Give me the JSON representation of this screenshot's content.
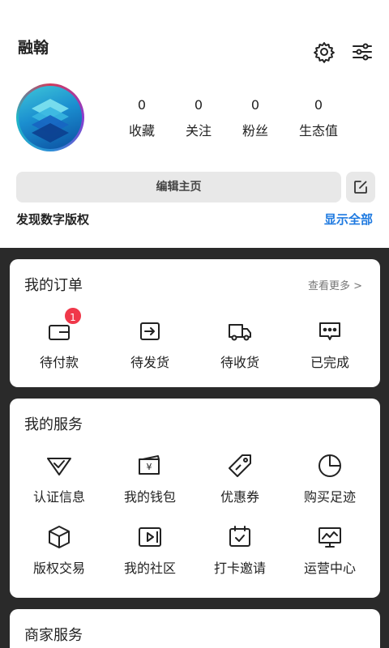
{
  "profile": {
    "username": "融翰",
    "stats": [
      {
        "value": "0",
        "label": "收藏"
      },
      {
        "value": "0",
        "label": "关注"
      },
      {
        "value": "0",
        "label": "粉丝"
      },
      {
        "value": "0",
        "label": "生态值"
      }
    ],
    "edit_button": "编辑主页",
    "discover": "发现数字版权",
    "show_all": "显示全部"
  },
  "orders": {
    "title": "我的订单",
    "more": "查看更多 >",
    "items": [
      {
        "label": "待付款",
        "icon": "wallet-icon",
        "badge": "1"
      },
      {
        "label": "待发货",
        "icon": "box-out-icon"
      },
      {
        "label": "待收货",
        "icon": "truck-icon"
      },
      {
        "label": "已完成",
        "icon": "message-dots-icon"
      }
    ]
  },
  "services": {
    "title": "我的服务",
    "items": [
      {
        "label": "认证信息",
        "icon": "check-shield-icon"
      },
      {
        "label": "我的钱包",
        "icon": "wallet-yen-icon"
      },
      {
        "label": "优惠券",
        "icon": "coupon-tag-icon"
      },
      {
        "label": "购买足迹",
        "icon": "pie-chart-icon"
      },
      {
        "label": "版权交易",
        "icon": "cube-icon"
      },
      {
        "label": "我的社区",
        "icon": "video-play-icon"
      },
      {
        "label": "打卡邀请",
        "icon": "calendar-check-icon"
      },
      {
        "label": "运营中心",
        "icon": "monitor-chart-icon"
      }
    ]
  },
  "merchant": {
    "title": "商家服务"
  },
  "colors": {
    "accent": "#1f7ae0",
    "badge": "#f0384a",
    "dark_bg": "#2a2a2a"
  }
}
